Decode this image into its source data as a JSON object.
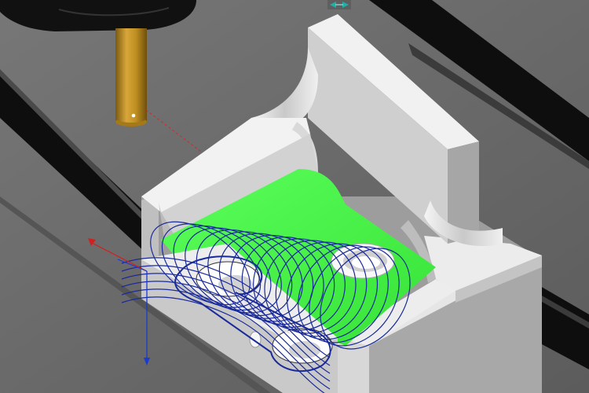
{
  "viewport": {
    "view_mode": "3d-shaded",
    "visible_text": ""
  },
  "colors": {
    "background": "#6b6b6b",
    "fixture_rail": "#0f0f0f",
    "workpiece": "#e9e9e9",
    "machined_floor": "#3cf03c",
    "toolpath": "#1a2a9a",
    "tool_shank": "#b8891c",
    "spindle": "#111111",
    "axis_x": "#d02020",
    "axis_z": "#1a3ad0",
    "gizmo": "#1fb0a8",
    "tool_projection": "#e02020"
  },
  "icons": {
    "axis_triad": "axis-triad-icon",
    "view_gizmo": "rotation-gizmo-icon"
  }
}
